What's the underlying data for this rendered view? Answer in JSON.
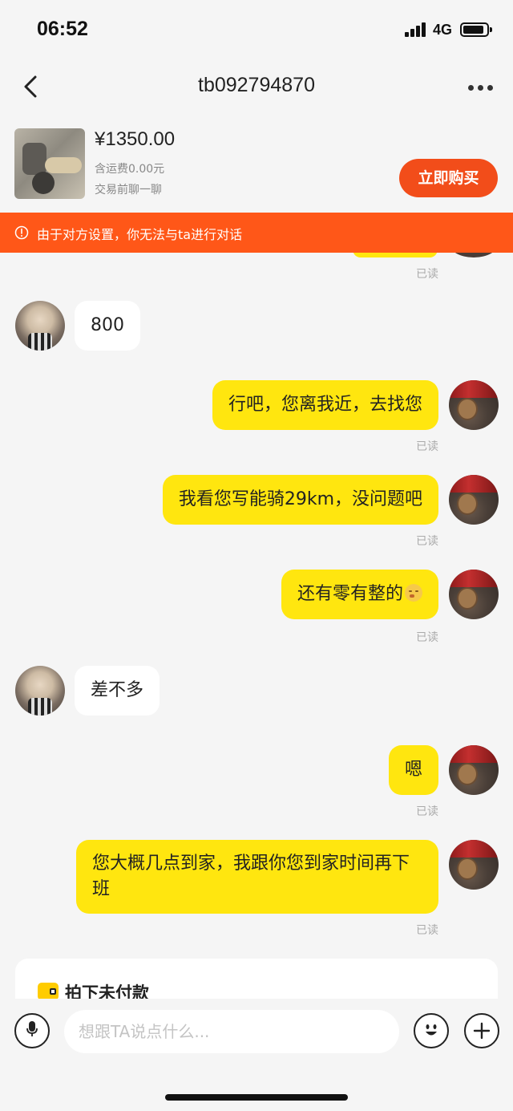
{
  "status_bar": {
    "time": "06:52",
    "network": "4G"
  },
  "header": {
    "title": "tb092794870"
  },
  "product": {
    "price": "¥1350.00",
    "shipping": "含运费0.00元",
    "subtitle": "交易前聊一聊",
    "buy_label": "立即购买"
  },
  "notice": {
    "text": "由于对方设置，你无法与ta进行对话",
    "color": "#ff5718"
  },
  "read_label": "已读",
  "messages": [
    {
      "side": "left",
      "text": "800"
    },
    {
      "side": "right",
      "text": "行吧，您离我近，去找您",
      "status": "已读"
    },
    {
      "side": "right",
      "text": "我看您写能骑29km，没问题吧",
      "status": "已读"
    },
    {
      "side": "right",
      "text": "还有零有整的",
      "emoji": "relieved-face",
      "status": "已读"
    },
    {
      "side": "left",
      "text": "差不多"
    },
    {
      "side": "right",
      "text": "嗯",
      "status": "已读"
    },
    {
      "side": "right",
      "text": "您大概几点到家，我跟你您到家时间再下班",
      "status": "已读"
    }
  ],
  "pending_card": {
    "title": "拍下未付款"
  },
  "input": {
    "placeholder": "想跟TA说点什么..."
  },
  "colors": {
    "self_bubble": "#ffe60f",
    "other_bubble": "#ffffff",
    "accent": "#f24d1a"
  }
}
